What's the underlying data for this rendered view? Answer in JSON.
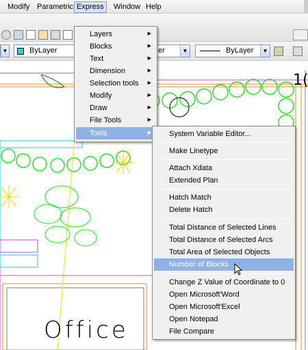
{
  "menubar": {
    "items": [
      "Modify",
      "Parametric",
      "Express",
      "Window",
      "Help"
    ]
  },
  "toolbar": {
    "color_combo": "ByLayer",
    "linetype_combo": "ByLayer",
    "partial_combo": "er"
  },
  "drawing": {
    "office_label": "Office",
    "corner_text": "1("
  },
  "express_menu": {
    "items": [
      "Layers",
      "Blocks",
      "Text",
      "Dimension",
      "Selection tools",
      "Modify",
      "Draw",
      "File Tools",
      "Tools"
    ]
  },
  "tools_submenu": {
    "group1": [
      "System Variable Editor..."
    ],
    "group2": [
      "Make Linetype"
    ],
    "group3": [
      "Attach Xdata",
      "Extended Plan"
    ],
    "group4": [
      "Hatch Match",
      "Delete Hatch"
    ],
    "group5": [
      "Total Distance of Selected Lines",
      "Total Distance of Selected Arcs",
      "Total Area of Selected Objects",
      "Number of Blocks"
    ],
    "group6": [
      "Change Z Value of Coordinate to 0",
      "Open Microsoft'Word",
      "Open Microsoft'Excel",
      "Open Notepad",
      "File Compare"
    ]
  }
}
